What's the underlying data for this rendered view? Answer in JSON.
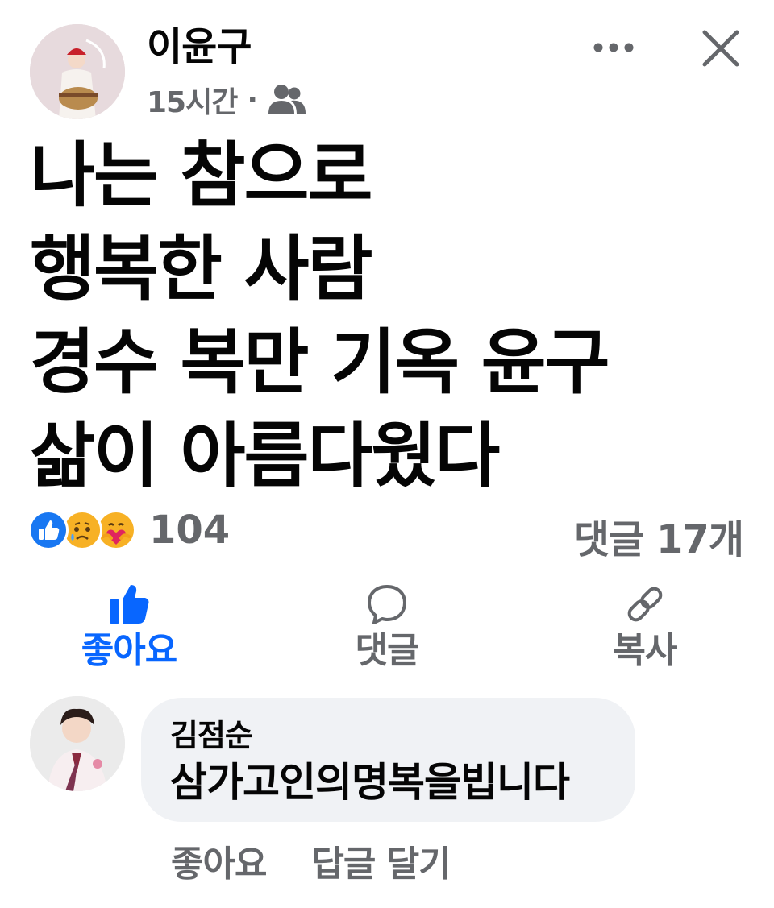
{
  "post": {
    "author": "이윤구",
    "time": "15시간",
    "separator": "·",
    "audience_icon": "friends-icon",
    "body_lines": [
      "나는 참으로",
      "행복한 사람",
      "경수 복만 기옥 윤구",
      "삶이 아름다웠다"
    ]
  },
  "reactions": {
    "icons": [
      "like-reaction-icon",
      "sad-reaction-icon",
      "care-reaction-icon"
    ],
    "count": "104",
    "comment_count": "댓글 17개"
  },
  "actions": {
    "like": "좋아요",
    "comment": "댓글",
    "copy": "복사"
  },
  "comment": {
    "author": "김점순",
    "text": "삼가고인의명복을빕니다",
    "like": "좋아요",
    "reply": "답글 달기"
  },
  "colors": {
    "accent": "#0866ff",
    "secondary_text": "#65676b",
    "bubble": "#f0f2f5"
  }
}
